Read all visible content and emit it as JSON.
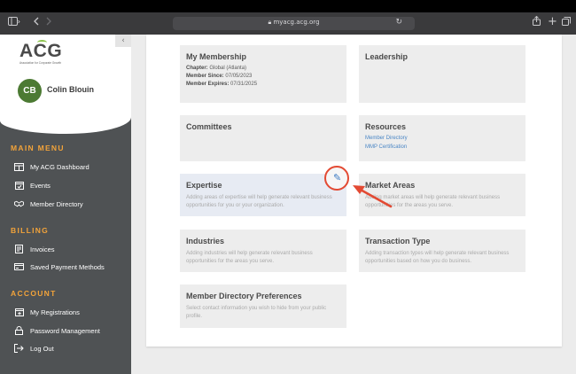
{
  "browser": {
    "url": "myacg.acg.org",
    "icons": {
      "sidebar": "sidebar-toggle-icon",
      "back": "back-icon",
      "forward": "forward-icon",
      "lock": "lock-icon",
      "reload": "reload-icon",
      "share": "share-icon",
      "newtab": "new-tab-icon",
      "tabs": "tabs-icon"
    }
  },
  "brand": {
    "logo_text": "ACG",
    "logo_sub": "Association for Corporate Growth",
    "accent": "#f2a33a",
    "sidebar_bg": "#4f5254"
  },
  "user": {
    "initials": "CB",
    "name": "Colin Blouin",
    "avatar_color": "#4c7a33"
  },
  "sidebar": {
    "collapse_glyph": "‹",
    "sections": [
      {
        "title": "MAIN MENU",
        "items": [
          {
            "label": "My ACG Dashboard",
            "icon": "dashboard-icon"
          },
          {
            "label": "Events",
            "icon": "calendar-check-icon"
          },
          {
            "label": "Member Directory",
            "icon": "handshake-icon"
          }
        ]
      },
      {
        "title": "BILLING",
        "items": [
          {
            "label": "Invoices",
            "icon": "invoice-icon"
          },
          {
            "label": "Saved Payment Methods",
            "icon": "credit-card-icon"
          }
        ]
      },
      {
        "title": "ACCOUNT",
        "items": [
          {
            "label": "My Registrations",
            "icon": "calendar-plus-icon"
          },
          {
            "label": "Password Management",
            "icon": "lock-icon"
          },
          {
            "label": "Log Out",
            "icon": "logout-icon"
          }
        ]
      }
    ]
  },
  "cards": {
    "membership": {
      "title": "My Membership",
      "chapter_label": "Chapter:",
      "chapter_value": "Global (Atlanta)",
      "since_label": "Member Since:",
      "since_value": "07/05/2023",
      "expires_label": "Member Expires:",
      "expires_value": "07/31/2025"
    },
    "leadership": {
      "title": "Leadership"
    },
    "committees": {
      "title": "Committees"
    },
    "resources": {
      "title": "Resources",
      "links": [
        "Member Directory",
        "MMP Certification"
      ]
    },
    "expertise": {
      "title": "Expertise",
      "desc": "Adding areas of expertise will help generate relevant business opportunities for you or your organization."
    },
    "market_areas": {
      "title": "Market Areas",
      "desc": "Adding market areas will help generate relevant business opportunities for the areas you serve."
    },
    "industries": {
      "title": "Industries",
      "desc": "Adding industries will help generate relevant business opportunities for the areas you serve."
    },
    "transaction_type": {
      "title": "Transaction Type",
      "desc": "Adding transaction types will help generate relevant business opportunities based on how you do business."
    },
    "directory_prefs": {
      "title": "Member Directory Preferences",
      "desc": "Select contact information you wish to hide from your public profile."
    }
  },
  "annotation": {
    "color": "#e34a33",
    "icon": "pencil-icon"
  }
}
